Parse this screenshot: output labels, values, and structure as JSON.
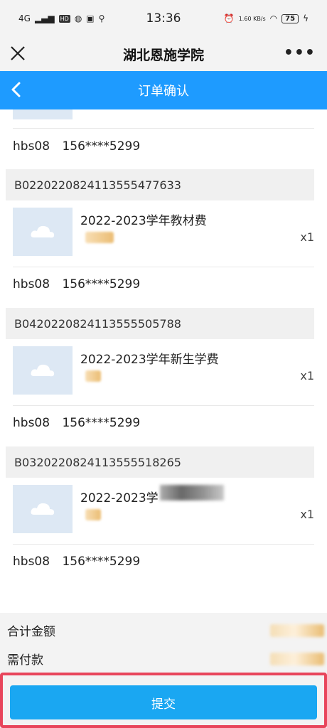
{
  "status_bar": {
    "time": "13:36",
    "network": "4G",
    "hd_badge": "HD",
    "speed": "1.60 KB/s",
    "battery": "75"
  },
  "title_bar": {
    "title": "湖北恩施学院",
    "more_label": "•••"
  },
  "nav_bar": {
    "title": "订单确认"
  },
  "orders": [
    {
      "contact_name": "hbs08",
      "contact_phone": "156****5299"
    },
    {
      "order_no": "B0220220824113555477633",
      "item_name": "2022-2023学年教材费",
      "quantity": "x1",
      "contact_name": "hbs08",
      "contact_phone": "156****5299"
    },
    {
      "order_no": "B0420220824113555505788",
      "item_name": "2022-2023学年新生学费",
      "quantity": "x1",
      "contact_name": "hbs08",
      "contact_phone": "156****5299"
    },
    {
      "order_no": "B0320220824113555518265",
      "item_name": "2022-2023学",
      "quantity": "x1",
      "contact_name": "hbs08",
      "contact_phone": "156****5299"
    }
  ],
  "summary": {
    "total_label": "合计金额",
    "payable_label": "需付款"
  },
  "submit": {
    "label": "提交"
  },
  "colors": {
    "accent": "#1e9bff",
    "submit": "#1aa7f2",
    "highlight_border": "#e8455b"
  }
}
